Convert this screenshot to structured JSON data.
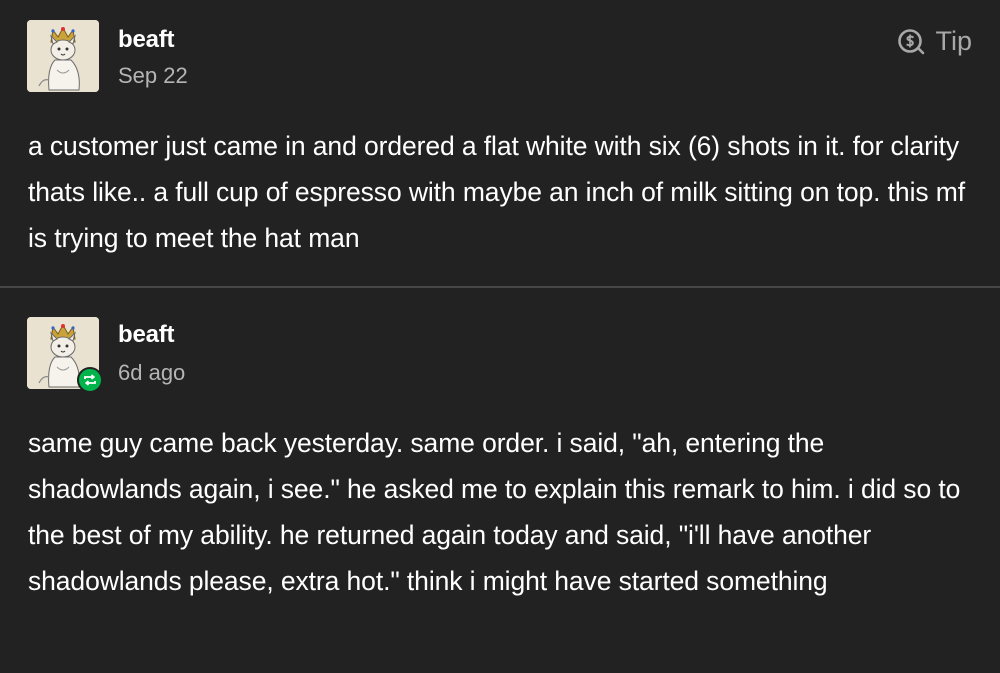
{
  "posts": [
    {
      "username": "beaft",
      "timestamp": "Sep 22",
      "tip_label": "Tip",
      "avatar_icon": "crowned-cat-avatar",
      "body": "a customer just came in and ordered a flat white with six (6) shots in it. for clarity thats like.. a full cup of espresso with maybe an inch of milk sitting on top. this mf is trying to meet the hat man"
    },
    {
      "username": "beaft",
      "timestamp": "6d ago",
      "avatar_icon": "crowned-cat-avatar",
      "badge_icon": "reblog-icon",
      "body": "same guy came back yesterday. same order. i said, \"ah, entering the shadowlands again, i see.\" he asked me to explain this remark to him. i did so to the best of my ability. he returned again today and said, \"i'll have another shadowlands please, extra hot.\" think i might have started something"
    }
  ],
  "colors": {
    "background": "#222222",
    "text": "#ffffff",
    "muted": "#b5b5b5",
    "divider": "#474747",
    "reblog_badge": "#00b34a"
  }
}
